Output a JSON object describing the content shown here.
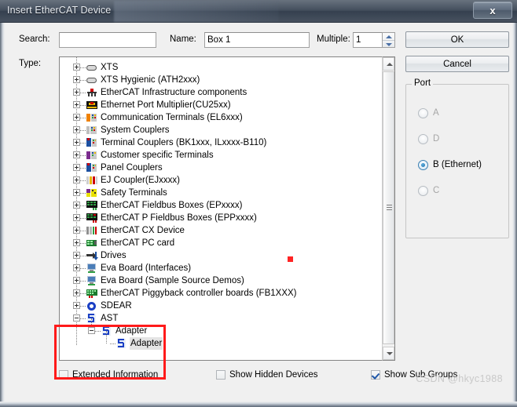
{
  "window": {
    "title": "Insert EtherCAT Device",
    "close_label": "x"
  },
  "toolbar": {
    "search_label": "Search:",
    "search_value": "",
    "name_label": "Name:",
    "name_value": "Box 1",
    "multiple_label": "Multiple:",
    "multiple_value": "1",
    "ok_label": "OK",
    "cancel_label": "Cancel"
  },
  "type": {
    "label": "Type:",
    "items": [
      {
        "label": "XTS",
        "depth": 1,
        "expander": "plus",
        "icon": "capsule-grey-icon"
      },
      {
        "label": "XTS Hygienic (ATH2xxx)",
        "depth": 1,
        "expander": "plus",
        "icon": "capsule-grey-icon"
      },
      {
        "label": "EtherCAT Infrastructure components",
        "depth": 1,
        "expander": "plus",
        "icon": "infrastructure-icon"
      },
      {
        "label": "Ethernet Port Multiplier(CU25xx)",
        "depth": 1,
        "expander": "plus",
        "icon": "port-multiplier-icon"
      },
      {
        "label": "Communication Terminals (EL6xxx)",
        "depth": 1,
        "expander": "plus",
        "icon": "terminal-orange-icon"
      },
      {
        "label": "System Couplers",
        "depth": 1,
        "expander": "plus",
        "icon": "terminal-grey-icon"
      },
      {
        "label": "Terminal Couplers (BK1xxx, ILxxxx-B110)",
        "depth": 1,
        "expander": "plus",
        "icon": "terminal-coupler-icon"
      },
      {
        "label": "Customer specific Terminals",
        "depth": 1,
        "expander": "plus",
        "icon": "terminal-purple-icon"
      },
      {
        "label": "Panel Couplers",
        "depth": 1,
        "expander": "plus",
        "icon": "terminal-coupler-icon"
      },
      {
        "label": "EJ Coupler(EJxxxx)",
        "depth": 1,
        "expander": "plus",
        "icon": "ej-coupler-icon"
      },
      {
        "label": "Safety Terminals",
        "depth": 1,
        "expander": "plus",
        "icon": "terminal-yellow-icon"
      },
      {
        "label": "EtherCAT Fieldbus Boxes (EPxxxx)",
        "depth": 1,
        "expander": "plus",
        "icon": "fieldbus-box-icon"
      },
      {
        "label": "EtherCAT P Fieldbus Boxes (EPPxxxx)",
        "depth": 1,
        "expander": "plus",
        "icon": "fieldbus-box-p-icon"
      },
      {
        "label": "EtherCAT CX Device",
        "depth": 1,
        "expander": "plus",
        "icon": "cx-device-icon"
      },
      {
        "label": "EtherCAT PC card",
        "depth": 1,
        "expander": "plus",
        "icon": "pc-card-icon"
      },
      {
        "label": "Drives",
        "depth": 1,
        "expander": "plus",
        "icon": "drives-icon"
      },
      {
        "label": "Eva Board (Interfaces)",
        "depth": 1,
        "expander": "plus",
        "icon": "eva-board-icon"
      },
      {
        "label": "Eva Board (Sample Source Demos)",
        "depth": 1,
        "expander": "plus",
        "icon": "eva-board-icon"
      },
      {
        "label": "EtherCAT Piggyback controller boards (FB1XXX)",
        "depth": 1,
        "expander": "plus",
        "icon": "piggyback-icon"
      },
      {
        "label": "SDEAR",
        "depth": 1,
        "expander": "plus",
        "icon": "sdear-icon"
      },
      {
        "label": "AST",
        "depth": 1,
        "expander": "minus",
        "icon": "ast-icon"
      },
      {
        "label": "Adapter",
        "depth": 2,
        "expander": "minus",
        "icon": "ast-icon"
      },
      {
        "label": "Adapter",
        "depth": 3,
        "expander": "none",
        "icon": "ast-icon",
        "selected": true
      }
    ]
  },
  "port": {
    "title": "Port",
    "options": [
      {
        "label": "A",
        "selected": false,
        "enabled": false
      },
      {
        "label": "D",
        "selected": false,
        "enabled": false
      },
      {
        "label": "B (Ethernet)",
        "selected": true,
        "enabled": true
      },
      {
        "label": "C",
        "selected": false,
        "enabled": false
      }
    ]
  },
  "options": [
    {
      "label": "Extended Information",
      "checked": false
    },
    {
      "label": "Show Hidden Devices",
      "checked": false
    },
    {
      "label": "Show Sub Groups",
      "checked": true
    }
  ],
  "annotation": {
    "watermark": "CSDN @hkyc1988"
  },
  "colors": {
    "accent": "#3c7fb1",
    "highlight": "#ff1a1a",
    "titlebar": "#3f4a59"
  }
}
